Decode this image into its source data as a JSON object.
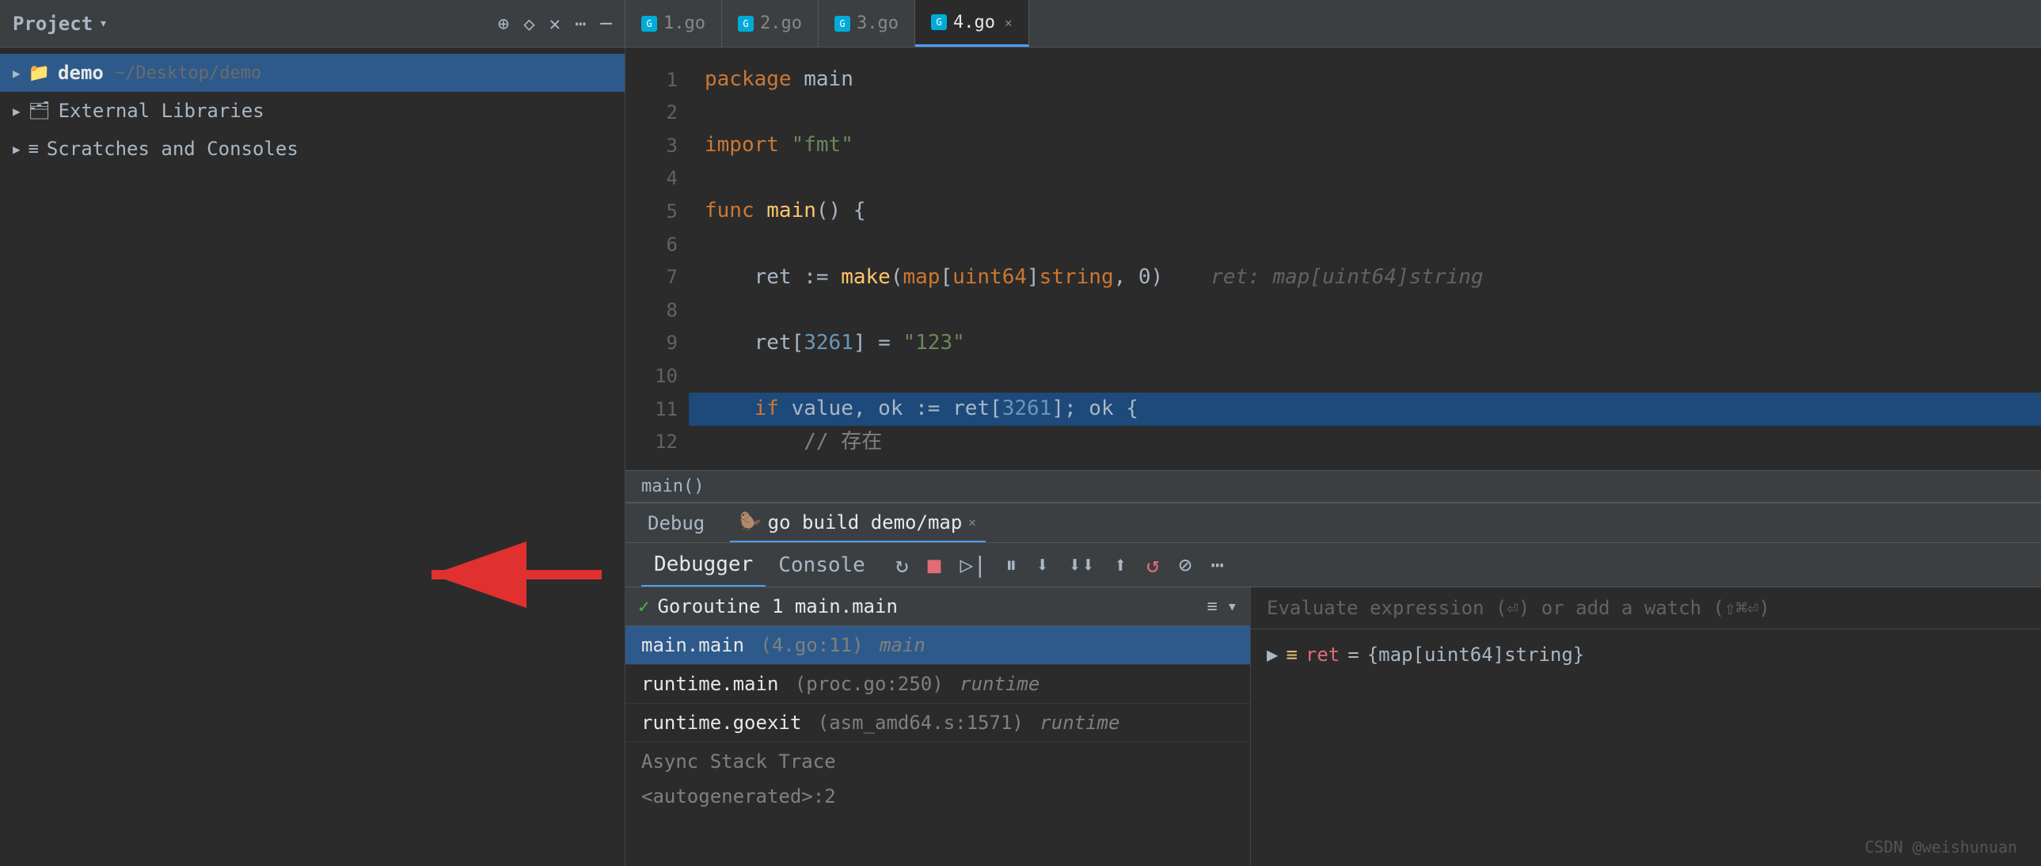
{
  "topbar": {
    "title": "Project",
    "icons": [
      "⊕",
      "⋄",
      "✕",
      "⋯",
      "─"
    ]
  },
  "sidebar": {
    "header": "Project",
    "items": [
      {
        "id": "demo",
        "label": "demo",
        "path": "~/Desktop/demo",
        "icon": "📁",
        "arrow": "▶",
        "selected": true
      },
      {
        "id": "external-libs",
        "label": "External Libraries",
        "icon": "📚",
        "arrow": "▶",
        "selected": false
      },
      {
        "id": "scratches",
        "label": "Scratches and Consoles",
        "icon": "≡",
        "arrow": "▶",
        "selected": false
      }
    ]
  },
  "editor": {
    "tabs": [
      {
        "id": "1go",
        "label": "1.go",
        "active": false
      },
      {
        "id": "2go",
        "label": "2.go",
        "active": false
      },
      {
        "id": "3go",
        "label": "3.go",
        "active": false
      },
      {
        "id": "4go",
        "label": "4.go",
        "active": true,
        "closeable": true
      }
    ],
    "lines": [
      {
        "num": 1,
        "content": "package main",
        "tokens": [
          {
            "t": "kw",
            "v": "package"
          },
          {
            "t": "plain",
            "v": " main"
          }
        ]
      },
      {
        "num": 2,
        "content": "",
        "tokens": []
      },
      {
        "num": 3,
        "content": "import \"fmt\"",
        "tokens": [
          {
            "t": "kw",
            "v": "import"
          },
          {
            "t": "plain",
            "v": " "
          },
          {
            "t": "str",
            "v": "\"fmt\""
          }
        ]
      },
      {
        "num": 4,
        "content": "",
        "tokens": []
      },
      {
        "num": 5,
        "content": "func main() {",
        "tokens": [
          {
            "t": "kw",
            "v": "func"
          },
          {
            "t": "plain",
            "v": " "
          },
          {
            "t": "fn",
            "v": "main"
          },
          {
            "t": "plain",
            "v": "() {"
          }
        ],
        "runBtn": true
      },
      {
        "num": 6,
        "content": "",
        "tokens": []
      },
      {
        "num": 7,
        "content": "    ret := make(map[uint64]string, 0)",
        "tokens": [
          {
            "t": "plain",
            "v": "    ret := "
          },
          {
            "t": "fn",
            "v": "make"
          },
          {
            "t": "plain",
            "v": "("
          },
          {
            "t": "kw",
            "v": "map"
          },
          {
            "t": "plain",
            "v": "["
          },
          {
            "t": "kw",
            "v": "uint64"
          },
          {
            "t": "plain",
            "v": "]}"
          },
          {
            "t": "kw",
            "v": "string"
          },
          {
            "t": "plain",
            "v": ", 0)"
          }
        ],
        "typeHint": "ret: map[uint64]string"
      },
      {
        "num": 8,
        "content": "",
        "tokens": []
      },
      {
        "num": 9,
        "content": "    ret[3261] = \"123\"",
        "tokens": [
          {
            "t": "plain",
            "v": "    ret["
          },
          {
            "t": "num",
            "v": "3261"
          },
          {
            "t": "plain",
            "v": "] = "
          },
          {
            "t": "str",
            "v": "\"123\""
          }
        ]
      },
      {
        "num": 10,
        "content": "",
        "tokens": []
      },
      {
        "num": 11,
        "content": "    if value, ok := ret[3261]; ok {",
        "tokens": [
          {
            "t": "plain",
            "v": "    "
          },
          {
            "t": "kw",
            "v": "if"
          },
          {
            "t": "plain",
            "v": " value, ok := ret["
          },
          {
            "t": "num",
            "v": "3261"
          },
          {
            "t": "plain",
            "v": "]; ok {"
          }
        ],
        "breakpoint": true,
        "highlighted": true
      },
      {
        "num": 12,
        "content": "        // 存在",
        "tokens": [
          {
            "t": "plain",
            "v": "        "
          },
          {
            "t": "cm",
            "v": "// 存在"
          }
        ]
      }
    ],
    "footer": "main()"
  },
  "debug": {
    "panel_tabs": [
      {
        "id": "debug",
        "label": "Debug",
        "active": false
      },
      {
        "id": "go-build",
        "label": "go build demo/map",
        "icon": "🦫",
        "active": true,
        "closeable": true
      }
    ],
    "toolbar": {
      "tabs": [
        {
          "id": "debugger",
          "label": "Debugger",
          "active": true
        },
        {
          "id": "console",
          "label": "Console",
          "active": false
        }
      ],
      "buttons": [
        {
          "id": "restart",
          "icon": "↻",
          "label": "restart"
        },
        {
          "id": "stop",
          "icon": "■",
          "label": "stop",
          "color": "#e06c75"
        },
        {
          "id": "resume",
          "icon": "▷|",
          "label": "resume"
        },
        {
          "id": "pause",
          "icon": "||",
          "label": "pause"
        },
        {
          "id": "step-over",
          "icon": "⬇",
          "label": "step-over"
        },
        {
          "id": "step-into",
          "icon": "⬇⬇",
          "label": "step-into"
        },
        {
          "id": "step-out",
          "icon": "⬆",
          "label": "step-out"
        },
        {
          "id": "reset",
          "icon": "↺",
          "label": "reset",
          "color": "#e06c75"
        },
        {
          "id": "mute",
          "icon": "⊘",
          "label": "mute",
          "color": "#a9b7c6"
        },
        {
          "id": "more",
          "icon": "⋯",
          "label": "more"
        }
      ]
    },
    "goroutine": {
      "label": "Goroutine 1 main.main",
      "check": "✓"
    },
    "stack_frames": [
      {
        "id": "frame1",
        "name": "main.main",
        "detail": "(4.go:11)",
        "italic": "main",
        "active": true
      },
      {
        "id": "frame2",
        "name": "runtime.main",
        "detail": "(proc.go:250)",
        "italic": "runtime",
        "active": false
      },
      {
        "id": "frame3",
        "name": "runtime.goexit",
        "detail": "(asm_amd64.s:1571)",
        "italic": "runtime",
        "active": false
      }
    ],
    "async_trace": "Async Stack Trace",
    "auto_generated": "<autogenerated>:2",
    "expression_placeholder": "Evaluate expression (⏎) or add a watch (⇧⌘⏎)",
    "variables": [
      {
        "id": "ret",
        "name": "ret",
        "value": "= {map[uint64]string}"
      }
    ]
  },
  "watermark": "CSDN @weishunuan"
}
